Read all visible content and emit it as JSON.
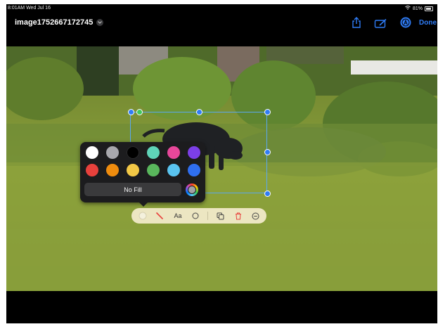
{
  "status_bar": {
    "time_date": "8:01AM  Wed Jul 16",
    "battery": "81%"
  },
  "header": {
    "filename": "image1752667172745",
    "done_label": "Done",
    "icons": [
      "share-icon",
      "markup-icon",
      "autofill-icon",
      "chevron-down-icon"
    ]
  },
  "colors": {
    "accent": "#2f7cf6",
    "palette_bg": "#1c1c1e",
    "toolbar_bg": "#ece6c2"
  },
  "palette": {
    "swatches": [
      {
        "name": "white",
        "color": "#ffffff"
      },
      {
        "name": "gray",
        "color": "#a8a8ad"
      },
      {
        "name": "black",
        "color": "#000000"
      },
      {
        "name": "mint",
        "color": "#5fd4b8"
      },
      {
        "name": "pink",
        "color": "#e8479a"
      },
      {
        "name": "purple",
        "color": "#7c3fe8"
      },
      {
        "name": "red",
        "color": "#e8413c"
      },
      {
        "name": "orange",
        "color": "#ef8c0e"
      },
      {
        "name": "yellow",
        "color": "#f3c846"
      },
      {
        "name": "green",
        "color": "#59b75c"
      },
      {
        "name": "light-blue",
        "color": "#5ac4f0"
      },
      {
        "name": "blue",
        "color": "#2f6ff0"
      }
    ],
    "no_fill_label": "No Fill"
  },
  "toolbar": {
    "text_label": "Aa",
    "icons": [
      "fill-color-icon",
      "stroke-icon",
      "text-style-icon",
      "shape-icon",
      "duplicate-icon",
      "trash-icon",
      "more-icon"
    ]
  }
}
